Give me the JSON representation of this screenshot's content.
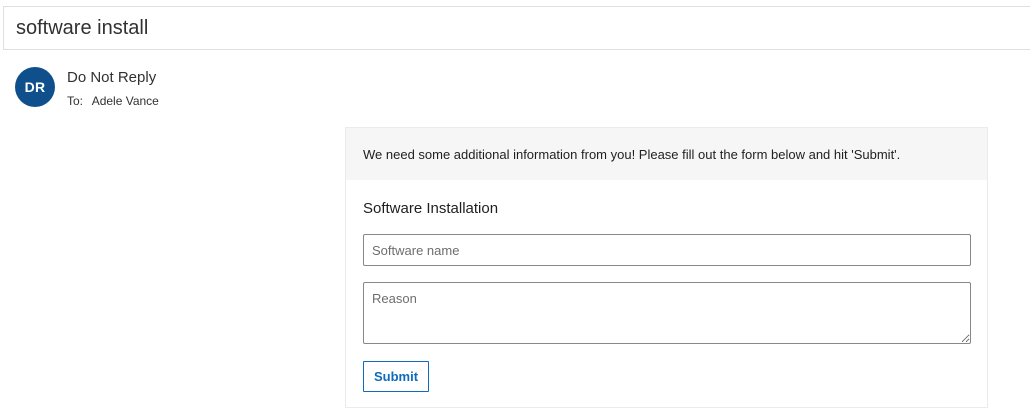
{
  "message": {
    "subject": "software install",
    "sender": {
      "initials": "DR",
      "name": "Do Not Reply",
      "avatar_color": "#0f4f8b"
    },
    "recipient": {
      "label": "To:",
      "name": "Adele Vance"
    }
  },
  "card": {
    "notice": "We need some additional information from you! Please fill out the form below and hit 'Submit'.",
    "form_title": "Software Installation",
    "software_field": {
      "placeholder": "Software name",
      "value": ""
    },
    "reason_field": {
      "placeholder": "Reason",
      "value": ""
    },
    "submit_label": "Submit",
    "accent_color": "#0f6cbd"
  }
}
